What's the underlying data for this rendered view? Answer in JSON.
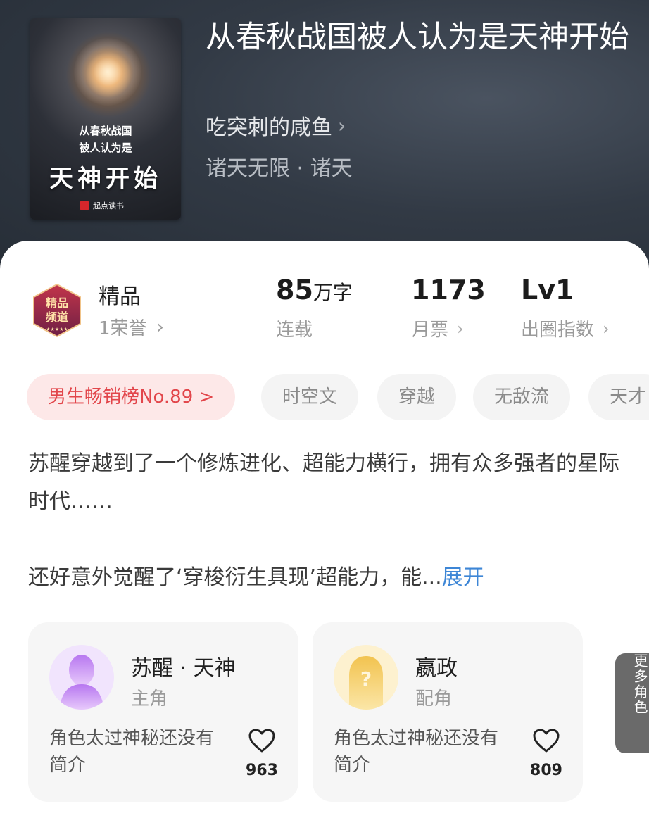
{
  "book": {
    "title": "从春秋战国被人认为是天神开始",
    "author": "吃突刺的咸鱼",
    "author_chevron": "›",
    "genre": "诸天无限 · 诸天",
    "cover": {
      "line1": "从春秋战国",
      "line2": "被人认为是",
      "main": "天神开始",
      "publisher": "起点读书"
    }
  },
  "stats": {
    "quality": {
      "label": "精品",
      "sub": "1荣誉",
      "badge_text": "精品频道"
    },
    "words": {
      "value": "85",
      "unit": "万字",
      "label": "连载"
    },
    "tickets": {
      "value": "1173",
      "label": "月票"
    },
    "circle": {
      "value": "Lv1",
      "label": "出圈指数"
    },
    "chevron": "›"
  },
  "tags": [
    {
      "label": "男生畅销榜No.89 >"
    },
    {
      "label": "时空文"
    },
    {
      "label": "穿越"
    },
    {
      "label": "无敌流"
    },
    {
      "label": "天才"
    }
  ],
  "intro": {
    "para1": "苏醒穿越到了一个修炼进化、超能力横行，拥有众多强者的星际时代……",
    "para2": "还好意外觉醒了‘穿梭衍生具现’超能力，能...",
    "expand": "展开"
  },
  "roles": [
    {
      "name": "苏醒 · 天神",
      "type": "主角",
      "desc": "角色太过神秘还没有简介",
      "likes": "963"
    },
    {
      "name": "嬴政",
      "type": "配角",
      "desc": "角色太过神秘还没有简介",
      "likes": "809"
    }
  ],
  "more_roles": "更多角色",
  "colors": {
    "rank_tag_text": "#e2464b",
    "rank_tag_bg": "#fde8e8",
    "expand_link": "#3d86d6"
  }
}
